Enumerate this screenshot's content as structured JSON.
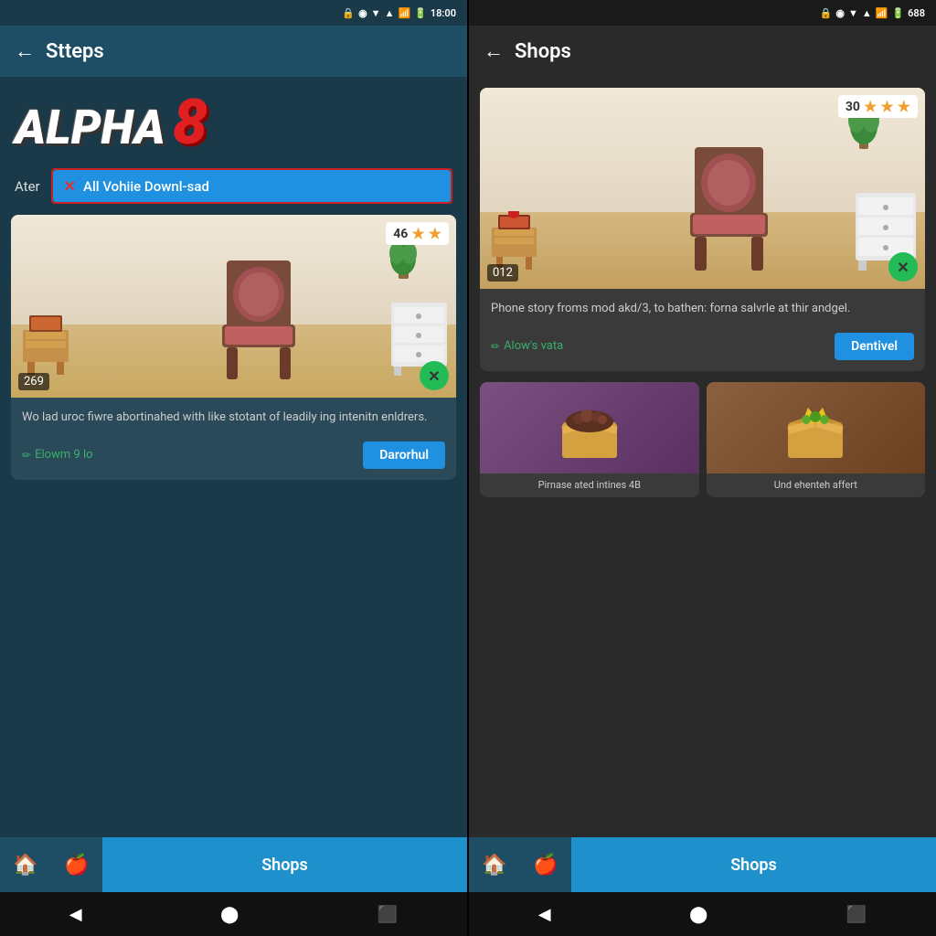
{
  "left_phone": {
    "status_bar": {
      "time": "18:00",
      "icons": "▼ ▲ 🔒 🔋"
    },
    "top_bar": {
      "back_label": "←",
      "title": "Stteps"
    },
    "alpha": {
      "text": "ALPHA",
      "number": "8"
    },
    "ater_label": "Ater",
    "download_button": "All Vohiie Downl-sad",
    "card": {
      "badge_number": "46",
      "id": "269",
      "description": "Wo lad uroc fiwre abortinahed with like stotant of leadily ing intenitn enldrers.",
      "link_text": "Elowm 9 lo",
      "action_button": "Darorhul"
    },
    "bottom_nav": {
      "shops_label": "Shops"
    }
  },
  "right_phone": {
    "status_bar": {
      "time": "688",
      "icons": "▼ ▲ 🔒 🔋"
    },
    "top_bar": {
      "back_label": "←",
      "title": "Shops"
    },
    "card": {
      "badge_number": "30",
      "id": "012",
      "description": "Phone story froms mod akd/3, to bathen: forna salvrle at thir andgel.",
      "link_text": "Alow's vata",
      "action_button": "Dentivel"
    },
    "shop_items": [
      {
        "id": "item-left",
        "label": "Pirnase ated intines\n4B"
      },
      {
        "id": "item-right",
        "label": "Und ehenteh\naffert"
      }
    ],
    "bottom_nav": {
      "shops_label": "Shops"
    }
  }
}
